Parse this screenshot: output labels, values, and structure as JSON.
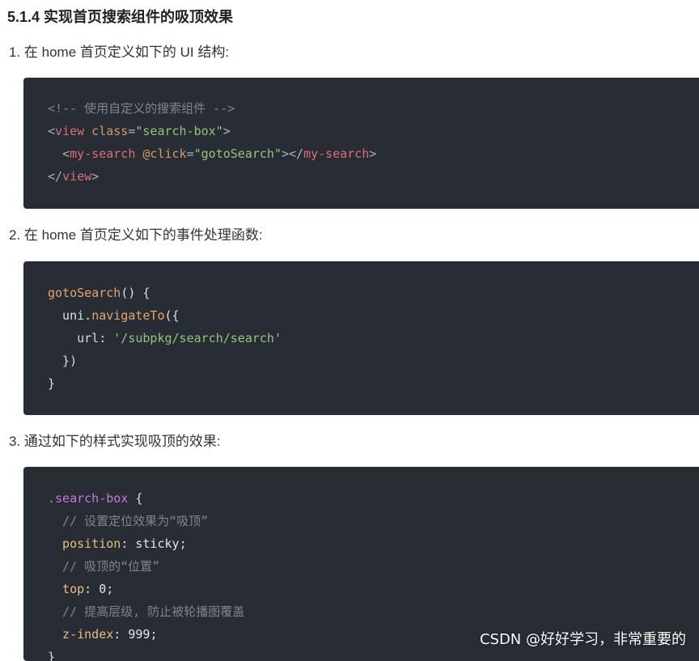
{
  "heading": "5.1.4 实现首页搜索组件的吸顶效果",
  "steps": [
    "1. 在 home 首页定义如下的 UI 结构:",
    "2. 在 home 首页定义如下的事件处理函数:",
    "3. 通过如下的样式实现吸顶的效果:"
  ],
  "code1": {
    "l1": "<!-- 使用自定义的搜索组件 -->",
    "l2_a": "<",
    "l2_tag": "view",
    "l2_attr": " class",
    "l2_eq": "=",
    "l2_str": "\"search-box\"",
    "l2_end": ">",
    "l3_a": "  <",
    "l3_tag": "my-search",
    "l3_attr": " @click",
    "l3_eq": "=",
    "l3_str": "\"gotoSearch\"",
    "l3_mid": "></",
    "l3_tag2": "my-search",
    "l3_end": ">",
    "l4_a": "</",
    "l4_tag": "view",
    "l4_end": ">"
  },
  "code2": {
    "l1_fn": "gotoSearch",
    "l1_rest": "() {",
    "l2_obj": "  uni",
    "l2_dot": ".",
    "l2_fn": "navigateTo",
    "l2_rest": "({",
    "l3_key": "    url",
    "l3_colon": ": ",
    "l3_str": "'/subpkg/search/search'",
    "l4": "  })",
    "l5": "}"
  },
  "code3": {
    "l1_sel": ".search-box",
    "l1_rest": " {",
    "l2": "  // 设置定位效果为“吸顶”",
    "l3_prop": "  position",
    "l3_colon": ": ",
    "l3_val": "sticky",
    "l3_semi": ";",
    "l4": "  // 吸顶的“位置”",
    "l5_prop": "  top",
    "l5_colon": ": ",
    "l5_val": "0",
    "l5_semi": ";",
    "l6": "  // 提高层级, 防止被轮播图覆盖",
    "l7_prop": "  z-index",
    "l7_colon": ": ",
    "l7_val": "999",
    "l7_semi": ";",
    "l8": "}"
  },
  "watermark": "CSDN @好好学习，非常重要的",
  "colors": {
    "code_bg": "#282c34",
    "tag": "#e06c75",
    "attr": "#d19a66",
    "string": "#98c379",
    "comment": "#7f848e",
    "selector": "#c678dd",
    "property": "#e5c07b"
  }
}
